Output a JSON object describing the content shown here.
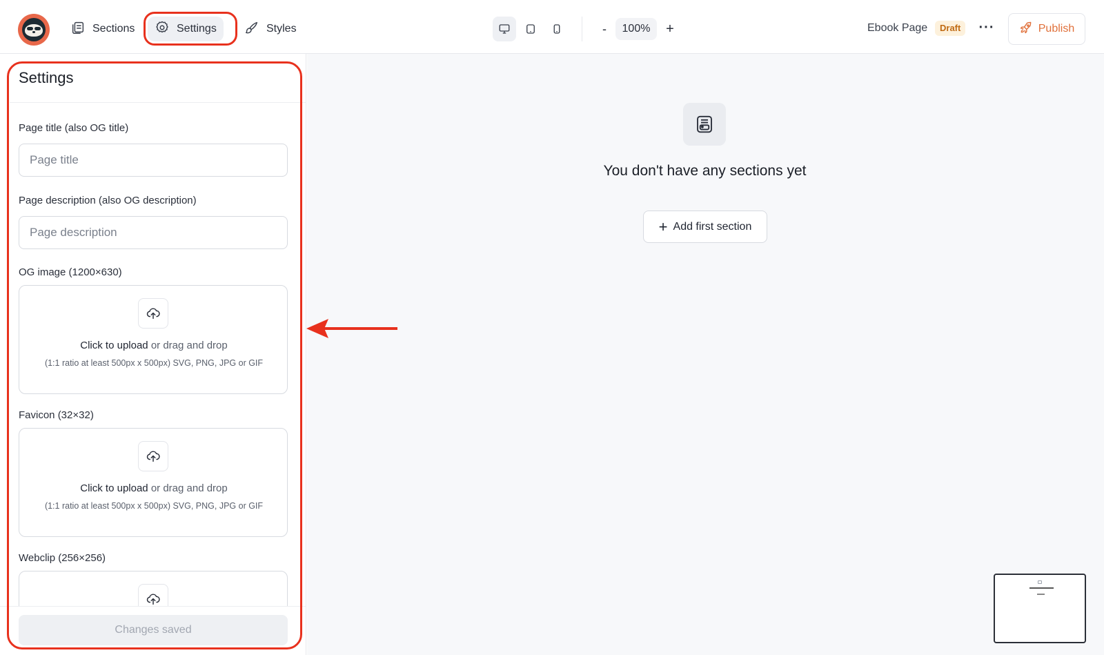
{
  "app": {
    "logo_alt": "sloth-logo"
  },
  "nav": {
    "tabs": [
      {
        "label": "Sections",
        "icon": "sections-icon"
      },
      {
        "label": "Settings",
        "icon": "gear-icon",
        "active": true
      },
      {
        "label": "Styles",
        "icon": "brush-icon"
      }
    ]
  },
  "toolbar": {
    "devices": [
      "desktop",
      "tablet",
      "mobile"
    ],
    "active_device": "desktop",
    "zoom_minus": "-",
    "zoom": "100%",
    "zoom_plus": "+",
    "page_name": "Ebook Page",
    "status_badge": "Draft",
    "more": "···",
    "publish_label": "Publish"
  },
  "settings_panel": {
    "title": "Settings",
    "page_title_label": "Page title (also OG title)",
    "page_title_placeholder": "Page title",
    "page_title_value": "",
    "page_description_label": "Page description (also OG description)",
    "page_description_placeholder": "Page description",
    "page_description_value": "",
    "uploads": [
      {
        "label": "OG image (1200×630)",
        "action": "Click to upload",
        "action_rest": " or drag and drop",
        "hint": "(1:1 ratio at least 500px x 500px) SVG, PNG, JPG or GIF"
      },
      {
        "label": "Favicon (32×32)",
        "action": "Click to upload",
        "action_rest": " or drag and drop",
        "hint": "(1:1 ratio at least 500px x 500px) SVG, PNG, JPG or GIF"
      },
      {
        "label": "Webclip (256×256)"
      }
    ],
    "footer_button": "Changes saved"
  },
  "canvas": {
    "empty_message": "You don't have any sections yet",
    "add_section_label": "Add first section"
  },
  "colors": {
    "annotation_red": "#e8311d",
    "publish_orange": "#e0703a",
    "draft_badge_bg": "#fdf1dc",
    "draft_badge_text": "#c06a12",
    "canvas_bg": "#f7f8fa"
  }
}
